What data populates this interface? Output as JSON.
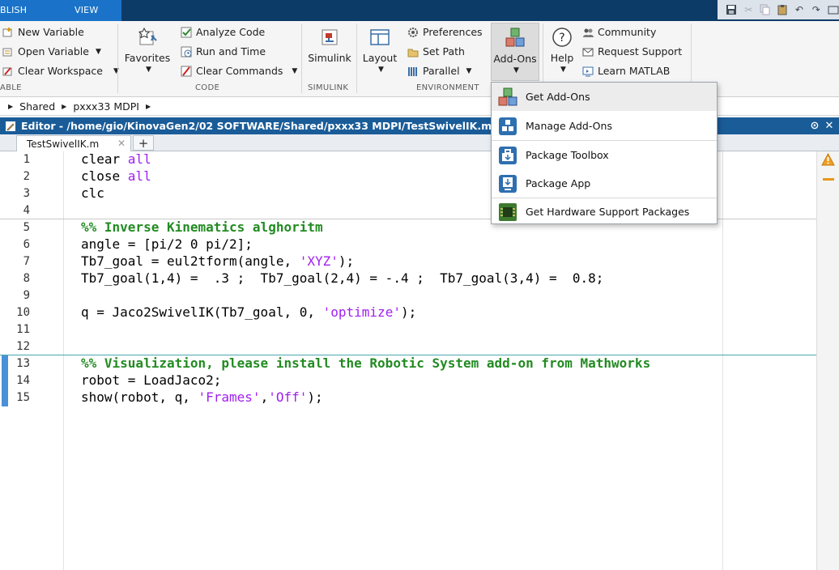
{
  "tabs": {
    "left_partial": "BLISH",
    "view": "VIEW"
  },
  "ribbon": {
    "variable": {
      "new_variable": "New Variable",
      "open_variable": "Open Variable",
      "clear_workspace": "Clear Workspace",
      "section_label": "ABLE"
    },
    "code": {
      "favorites": "Favorites",
      "analyze_code": "Analyze Code",
      "run_and_time": "Run and Time",
      "clear_commands": "Clear Commands",
      "section_label": "CODE"
    },
    "simulink": {
      "simulink": "Simulink",
      "section_label": "SIMULINK"
    },
    "environment": {
      "layout": "Layout",
      "preferences": "Preferences",
      "set_path": "Set Path",
      "parallel": "Parallel",
      "add_ons": "Add-Ons",
      "section_label": "ENVIRONMENT"
    },
    "resources": {
      "help": "Help",
      "community": "Community",
      "request_support": "Request Support",
      "learn_matlab": "Learn MATLAB"
    }
  },
  "breadcrumb": [
    "Shared",
    "pxxx33 MDPI"
  ],
  "editor": {
    "title": "Editor - /home/gio/KinovaGen2/02 SOFTWARE/Shared/pxxx33 MDPI/TestSwivelIK.m",
    "file_tab": "TestSwivelIK.m",
    "new_tab": "+",
    "lines": [
      {
        "n": "1",
        "parts": [
          [
            "t",
            "clear "
          ],
          [
            "kw",
            "all"
          ]
        ]
      },
      {
        "n": "2",
        "parts": [
          [
            "t",
            "close "
          ],
          [
            "kw",
            "all"
          ]
        ]
      },
      {
        "n": "3",
        "parts": [
          [
            "t",
            "clc"
          ]
        ]
      },
      {
        "n": "4",
        "parts": []
      },
      {
        "n": "5",
        "parts": [
          [
            "cmt",
            "%% Inverse Kinematics alghoritm"
          ]
        ]
      },
      {
        "n": "6",
        "parts": [
          [
            "t",
            "angle = [pi/2 0 pi/2];"
          ]
        ]
      },
      {
        "n": "7",
        "parts": [
          [
            "t",
            "Tb7_goal = eul2tform(angle, "
          ],
          [
            "str",
            "'XYZ'"
          ],
          [
            "t",
            ");"
          ]
        ]
      },
      {
        "n": "8",
        "parts": [
          [
            "t",
            "Tb7_goal(1,4) =  .3 ;  Tb7_goal(2,4) = -.4 ;  Tb7_goal(3,4) =  0.8;"
          ]
        ]
      },
      {
        "n": "9",
        "parts": []
      },
      {
        "n": "10",
        "parts": [
          [
            "t",
            "q = Jaco2SwivelIK(Tb7_goal, 0, "
          ],
          [
            "str",
            "'optimize'"
          ],
          [
            "t",
            ");"
          ]
        ]
      },
      {
        "n": "11",
        "parts": []
      },
      {
        "n": "12",
        "parts": []
      },
      {
        "n": "13",
        "parts": [
          [
            "cmt",
            "%% Visualization, please install the Robotic System add-on from Mathworks"
          ]
        ]
      },
      {
        "n": "14",
        "parts": [
          [
            "t",
            "robot = LoadJaco2;"
          ]
        ]
      },
      {
        "n": "15",
        "parts": [
          [
            "t",
            "show(robot, q, "
          ],
          [
            "str",
            "'Frames'"
          ],
          [
            "t",
            ","
          ],
          [
            "str",
            "'Off'"
          ],
          [
            "t",
            ");"
          ]
        ]
      }
    ]
  },
  "addons_menu": {
    "items": [
      {
        "label": "Get Add-Ons",
        "icon": "get-addons-icon"
      },
      {
        "label": "Manage Add-Ons",
        "icon": "manage-addons-icon"
      },
      {
        "label": "Package Toolbox",
        "icon": "package-toolbox-icon"
      },
      {
        "label": "Package App",
        "icon": "package-app-icon"
      },
      {
        "label": "Get Hardware Support Packages",
        "icon": "hardware-support-icon"
      }
    ]
  },
  "colors": {
    "title_bar": "#1a5c98",
    "tab_strip": "#0d3b68",
    "active_tab": "#1a73c8",
    "comment": "#228b22",
    "string": "#a020f0",
    "cell_bar": "#4a90d9",
    "warning": "#e8971a"
  }
}
